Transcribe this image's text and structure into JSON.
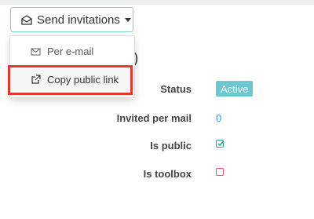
{
  "toolbar": {
    "send_invitations_label": "Send invitations"
  },
  "dropdown": {
    "items": [
      {
        "label": "Per e-mail",
        "icon": "envelope-icon"
      },
      {
        "label": "Copy public link",
        "icon": "external-link-icon"
      }
    ]
  },
  "title_fragment": ")",
  "details": {
    "status_label": "Status",
    "status_value": "Active",
    "invited_label": "Invited per mail",
    "invited_value": "0",
    "is_public_label": "Is public",
    "is_public_checked": true,
    "is_toolbox_label": "Is toolbox",
    "is_toolbox_checked": false
  },
  "colors": {
    "accent": "#6cc7cf",
    "button_border": "#7ecfd6",
    "highlight": "#e23a2a",
    "link": "#2b9fd9",
    "checked": "#2a9d8f",
    "unchecked": "#e05a6a"
  }
}
